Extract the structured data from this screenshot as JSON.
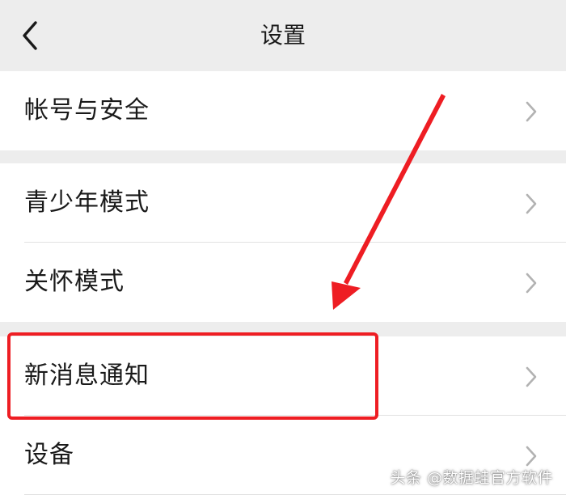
{
  "header": {
    "title": "设置",
    "back_icon": "chevron-left-icon"
  },
  "groups": [
    {
      "items": [
        {
          "label": "帐号与安全",
          "icon": "chevron-right-icon"
        }
      ]
    },
    {
      "items": [
        {
          "label": "青少年模式",
          "icon": "chevron-right-icon"
        },
        {
          "label": "关怀模式",
          "icon": "chevron-right-icon"
        }
      ]
    },
    {
      "items": [
        {
          "label": "新消息通知",
          "icon": "chevron-right-icon",
          "highlighted": true
        },
        {
          "label": "设备",
          "icon": "chevron-right-icon"
        }
      ]
    }
  ],
  "annotation": {
    "highlight_color": "#ee1d23",
    "arrow_color": "#ee1d23"
  },
  "watermark": {
    "text": "头条 @数据蛙官方软件"
  },
  "colors": {
    "background": "#ededed",
    "card": "#ffffff",
    "text": "#1a1a1a",
    "chevron": "#b2b2b2"
  }
}
